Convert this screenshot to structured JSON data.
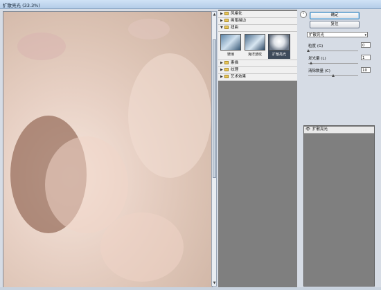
{
  "window": {
    "title": "扩散亮光 (33.3%)"
  },
  "filter_tree": {
    "categories": [
      {
        "label": "风格化",
        "expanded": false
      },
      {
        "label": "画笔描边",
        "expanded": false
      },
      {
        "label": "扭曲",
        "expanded": true
      },
      {
        "label": "素描",
        "expanded": false
      },
      {
        "label": "纹理",
        "expanded": false
      },
      {
        "label": "艺术效果",
        "expanded": false
      }
    ],
    "distort_thumbs": [
      {
        "label": "玻璃",
        "selected": false
      },
      {
        "label": "海洋波纹",
        "selected": false
      },
      {
        "label": "扩散亮光",
        "selected": true
      }
    ]
  },
  "buttons": {
    "ok": "确定",
    "reset": "复位"
  },
  "filter_select": {
    "value": "扩散亮光"
  },
  "params": [
    {
      "label": "粒度 (G)",
      "value": "0",
      "fraction": 0.0
    },
    {
      "label": "发光量 (L)",
      "value": "1",
      "fraction": 0.05
    },
    {
      "label": "清除数量 (C)",
      "value": "10",
      "fraction": 0.5
    }
  ],
  "layers": {
    "items": [
      {
        "name": "扩散亮光"
      }
    ]
  },
  "icons": {
    "collapse": "double-chevron-up-icon",
    "eye": "eye-icon",
    "folder": "folder-icon"
  }
}
